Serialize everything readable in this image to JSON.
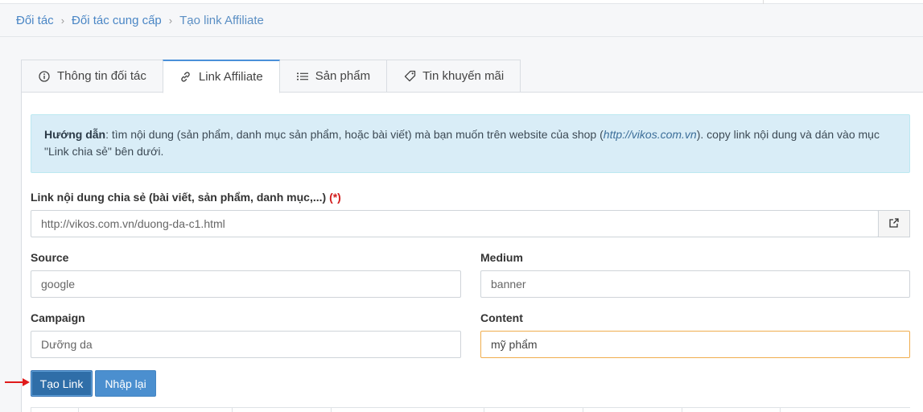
{
  "breadcrumb": {
    "items": [
      "Đối tác",
      "Đối tác cung cấp",
      "Tạo link Affiliate"
    ],
    "separator": "›"
  },
  "tabs": [
    {
      "label": "Thông tin đối tác",
      "icon": "info-icon",
      "active": false
    },
    {
      "label": "Link Affiliate",
      "icon": "link-icon",
      "active": true
    },
    {
      "label": "Sản phẩm",
      "icon": "list-icon",
      "active": false
    },
    {
      "label": "Tin khuyến mãi",
      "icon": "tag-icon",
      "active": false
    }
  ],
  "guide": {
    "title": "Hướng dẫn",
    "text_before": ": tìm nội dung (sản phẩm, danh mục sản phẩm, hoặc bài viết) mà bạn muốn trên website của shop (",
    "url": "http://vikos.com.vn",
    "text_after": "). copy link nội dung và dán vào mục \"Link chia sẻ\" bên dưới."
  },
  "form": {
    "link_label": "Link nội dung chia sẻ (bài viết, sản phẩm, danh mục,...)",
    "required_mark": "(*)",
    "link_value": "http://vikos.com.vn/duong-da-c1.html",
    "source_label": "Source",
    "source_value": "google",
    "medium_label": "Medium",
    "medium_value": "banner",
    "campaign_label": "Campaign",
    "campaign_value": "Dưỡng da",
    "content_label": "Content",
    "content_value": "mỹ phẩm"
  },
  "buttons": {
    "create": "Tạo Link",
    "reset": "Nhập lại"
  },
  "colors": {
    "accent": "#2f6ea8",
    "link": "#4a86c5",
    "info_bg": "#d9edf7",
    "focus_border": "#f0ad4e",
    "required": "#d21b1b",
    "arrow": "#e01b1b"
  }
}
